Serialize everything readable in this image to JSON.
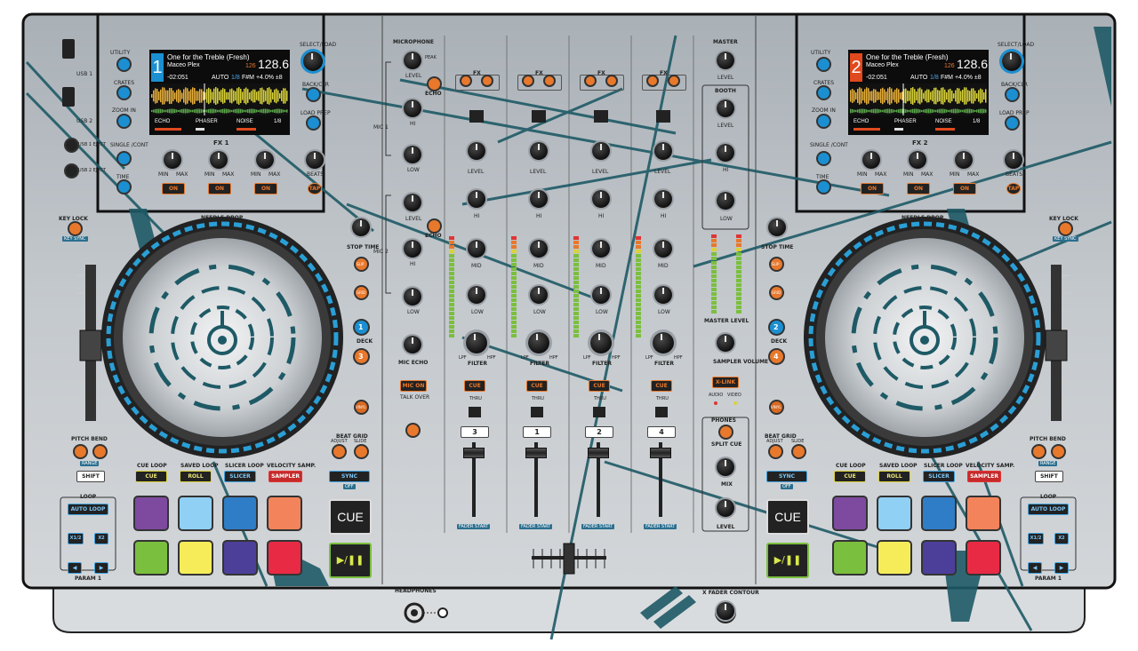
{
  "left_usb": {
    "usb1": "USB 1",
    "usb2": "USB 2",
    "usb1_eject": "USB 1 EJECT",
    "usb2_eject": "USB 2 EJECT"
  },
  "deck_left": {
    "deck_number": "1",
    "screen": {
      "track_title": "One for the Treble (Fresh)",
      "artist": "Maceo Plex",
      "bpm_small": "126",
      "bpm": "128.6",
      "time": "-02:051",
      "auto": "AUTO",
      "beat_fraction": "1/8",
      "key_info": "F#M +4.0%  ±8",
      "fx_slots": [
        "ECHO",
        "PHASER",
        "NOISE"
      ],
      "fx_beat": "1/8"
    },
    "side_buttons": [
      "UTILITY",
      "CRATES",
      "ZOOM IN",
      "SINGLE /CONT",
      "TIME"
    ],
    "right_buttons": {
      "select": "SELECT/LOAD",
      "back": "BACK/CLR",
      "load_prep": "LOAD PREP"
    },
    "fx_header": "FX 1",
    "knob_min": "MIN",
    "knob_max": "MAX",
    "on_label": "ON",
    "beats": "BEATS",
    "tap": "TAP",
    "needle_drop": "NEEDLE DROP",
    "key_lock": "KEY LOCK",
    "key_sync": "KEY SYNC",
    "stop_time": "STOP TIME",
    "slip": "SLIP",
    "grid": "GRID",
    "deck_label": "DECK",
    "deck_a": "1",
    "deck_b": "3",
    "vinyl": "VINYL",
    "pitch_bend": "PITCH BEND",
    "range": "RANGE",
    "shift": "SHIFT",
    "beat_grid": "BEAT GRID",
    "adjust": "ADJUST",
    "slide": "SLIDE",
    "sync": "SYNC",
    "off": "OFF",
    "pad_modes": [
      {
        "top": "CUE LOOP",
        "btn": "CUE"
      },
      {
        "top": "SAVED LOOP",
        "btn": "ROLL"
      },
      {
        "top": "SLICER LOOP",
        "btn": "SLICER"
      },
      {
        "top": "VELOCITY SAMP.",
        "btn": "SAMPLER"
      }
    ],
    "loop": "LOOP",
    "auto_loop": "AUTO LOOP",
    "x12": "X1/2",
    "x2": "X2",
    "param": "PARAM 1",
    "cue": "CUE",
    "play": "▶/❚❚"
  },
  "deck_right": {
    "deck_number": "2",
    "screen": {
      "track_title": "One for the Treble (Fresh)",
      "artist": "Maceo Plex",
      "bpm_small": "126",
      "bpm": "128.6",
      "time": "-02:051",
      "auto": "AUTO",
      "beat_fraction": "1/8",
      "key_info": "F#M +4.0%  ±8",
      "fx_slots": [
        "ECHO",
        "PHASER",
        "NOISE"
      ],
      "fx_beat": "1/8"
    },
    "fx_header": "FX 2",
    "deck_a": "2",
    "deck_b": "4"
  },
  "mixer": {
    "microphone": "MICROPHONE",
    "mic1": "MIC 1",
    "mic2": "MIC 2",
    "peak": "PEAK",
    "level": "LEVEL",
    "echo": "ECHO",
    "hi": "HI",
    "low": "LOW",
    "mid": "MID",
    "mic_echo": "MIC ECHO",
    "mic_on": "MIC ON",
    "talk_over": "TALK OVER",
    "fx": "FX",
    "filter": "FILTER",
    "lpf": "LPF",
    "hpf": "HPF",
    "cue": "CUE",
    "thru": "THRU",
    "channel_numbers": [
      "3",
      "1",
      "2",
      "4"
    ],
    "fader_start": "FADER START",
    "master": "MASTER",
    "booth": "BOOTH",
    "master_level": "MASTER LEVEL",
    "sampler_volume": "SAMPLER VOLUME",
    "xlink": "X-LINK",
    "audio": "AUDIO",
    "video": "VIDEO",
    "phones": "PHONES",
    "split_cue": "SPLIT CUE",
    "mix": "MIX",
    "headphones": "HEADPHONES",
    "xfader_contour": "X FADER CONTOUR"
  },
  "colors": {
    "body": "#b7bdc2",
    "accent_teal": "#1e5a66",
    "jog_ring_blue": "#2a9fd6",
    "button_orange": "#e8782c",
    "deck1_blue": "#1b8fd1",
    "deck2_red": "#e04a1e"
  }
}
